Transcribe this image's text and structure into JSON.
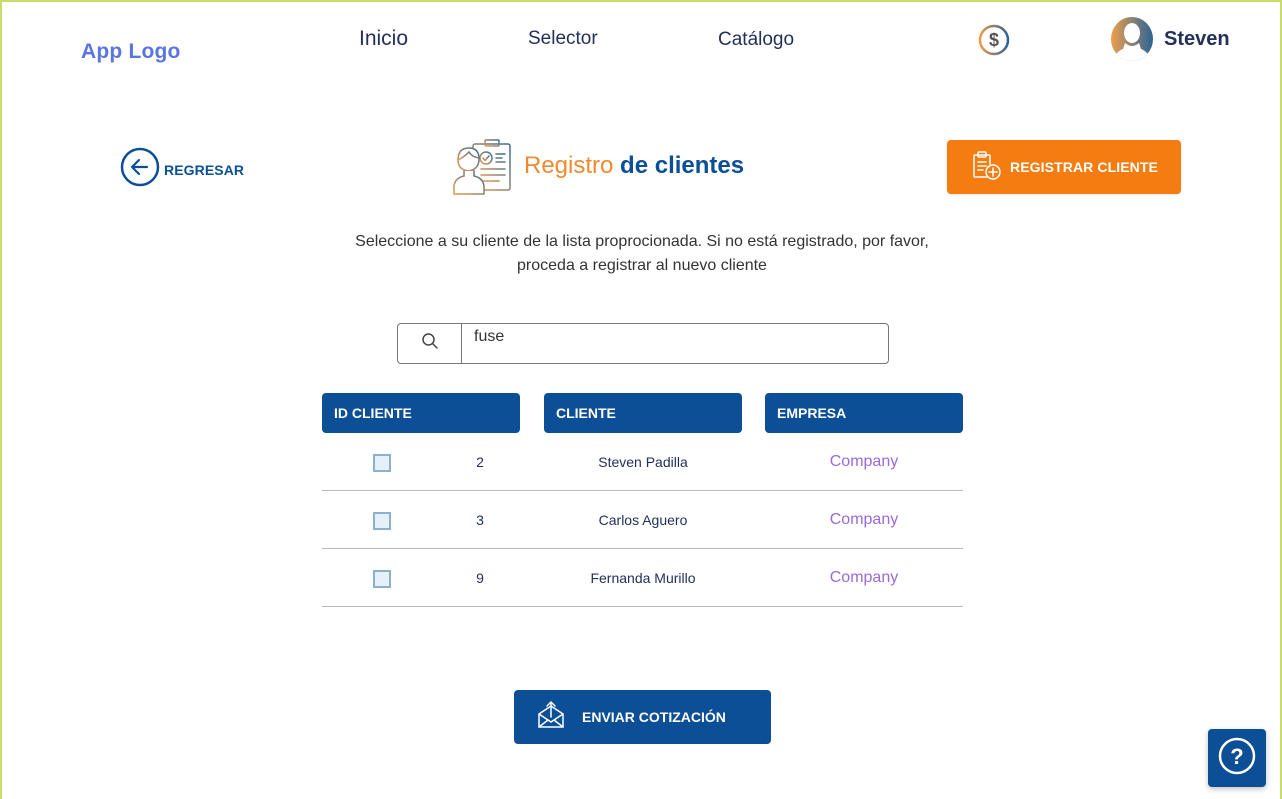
{
  "header": {
    "logo": "App Logo",
    "nav": [
      {
        "label": "Inicio"
      },
      {
        "label": "Selector"
      },
      {
        "label": "Catálogo"
      }
    ],
    "coin_icon": "dollar-coin-icon",
    "user": {
      "name": "Steven",
      "avatar_icon": "user-avatar-icon"
    }
  },
  "page": {
    "back_label": "REGRESAR",
    "title_part1": "Registro",
    "title_part2": "de clientes",
    "register_button": "REGISTRAR CLIENTE",
    "instructions_line1": "Seleccione a su cliente de la lista proprocionada. Si no está registrado, por favor,",
    "instructions_line2": "proceda a registrar al nuevo cliente"
  },
  "search": {
    "value": "fuse",
    "placeholder": ""
  },
  "table": {
    "headers": [
      "ID CLIENTE",
      "CLIENTE",
      "EMPRESA"
    ],
    "rows": [
      {
        "checked": false,
        "id": "2",
        "cliente": "Steven  Padilla",
        "empresa": "Company"
      },
      {
        "checked": false,
        "id": "3",
        "cliente": "Carlos  Aguero",
        "empresa": "Company"
      },
      {
        "checked": false,
        "id": "9",
        "cliente": "Fernanda Murillo",
        "empresa": "Company"
      }
    ]
  },
  "footer": {
    "send_button": "ENVIAR COTIZACIÓN",
    "help_icon": "help-icon"
  },
  "colors": {
    "primary": "#0c4f96",
    "accent": "#f57c10",
    "logo": "#5a74e3",
    "company_link": "#9b6ad8"
  }
}
